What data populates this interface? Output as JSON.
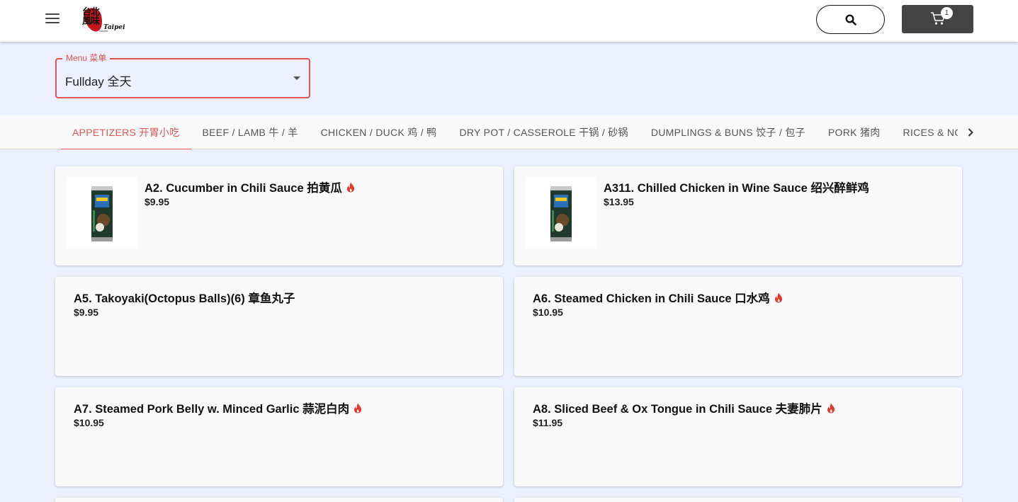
{
  "header": {
    "logo": {
      "cn": "台北風味",
      "en": "Taipei",
      "sub": "cuisine"
    },
    "cart_count": "1"
  },
  "menu_select": {
    "label": "Menu 菜单",
    "value": "Fullday 全天"
  },
  "tabs": [
    {
      "label": "APPETIZERS 开胃小吃",
      "active": true
    },
    {
      "label": "BEEF / LAMB 牛 / 羊"
    },
    {
      "label": "CHICKEN / DUCK 鸡 / 鸭"
    },
    {
      "label": "DRY POT / CASSEROLE 干锅 / 砂锅"
    },
    {
      "label": "DUMPLINGS & BUNS 饺子 / 包子"
    },
    {
      "label": "PORK 猪肉"
    },
    {
      "label": "RICES & NOODLES"
    }
  ],
  "items": [
    {
      "name": "A2. Cucumber in Chili Sauce 拍黄瓜",
      "price": "$9.95",
      "spicy": true,
      "image": "can-drink-image"
    },
    {
      "name": "A311. Chilled Chicken in Wine Sauce 绍兴醉鲜鸡",
      "price": "$13.95",
      "spicy": false,
      "image": "can-drink-image"
    },
    {
      "name": "A5. Takoyaki(Octopus Balls)(6) 章鱼丸子",
      "price": "$9.95",
      "spicy": false
    },
    {
      "name": "A6. Steamed Chicken in Chili Sauce 口水鸡",
      "price": "$10.95",
      "spicy": true
    },
    {
      "name": "A7. Steamed Pork Belly w. Minced Garlic 蒜泥白肉",
      "price": "$10.95",
      "spicy": true
    },
    {
      "name": "A8. Sliced Beef & Ox Tongue in Chili Sauce 夫妻肺片",
      "price": "$11.95",
      "spicy": true
    }
  ],
  "icons": {
    "menu": "hamburger-icon",
    "search": "search-icon",
    "cart": "cart-icon",
    "spicy": "flame-icon",
    "scroll": "chevron-right-icon"
  },
  "colors": {
    "accent": "#e05555",
    "spicy": "#e03a2a",
    "cart_button": "#444444",
    "page_bg": "#eceffd"
  }
}
